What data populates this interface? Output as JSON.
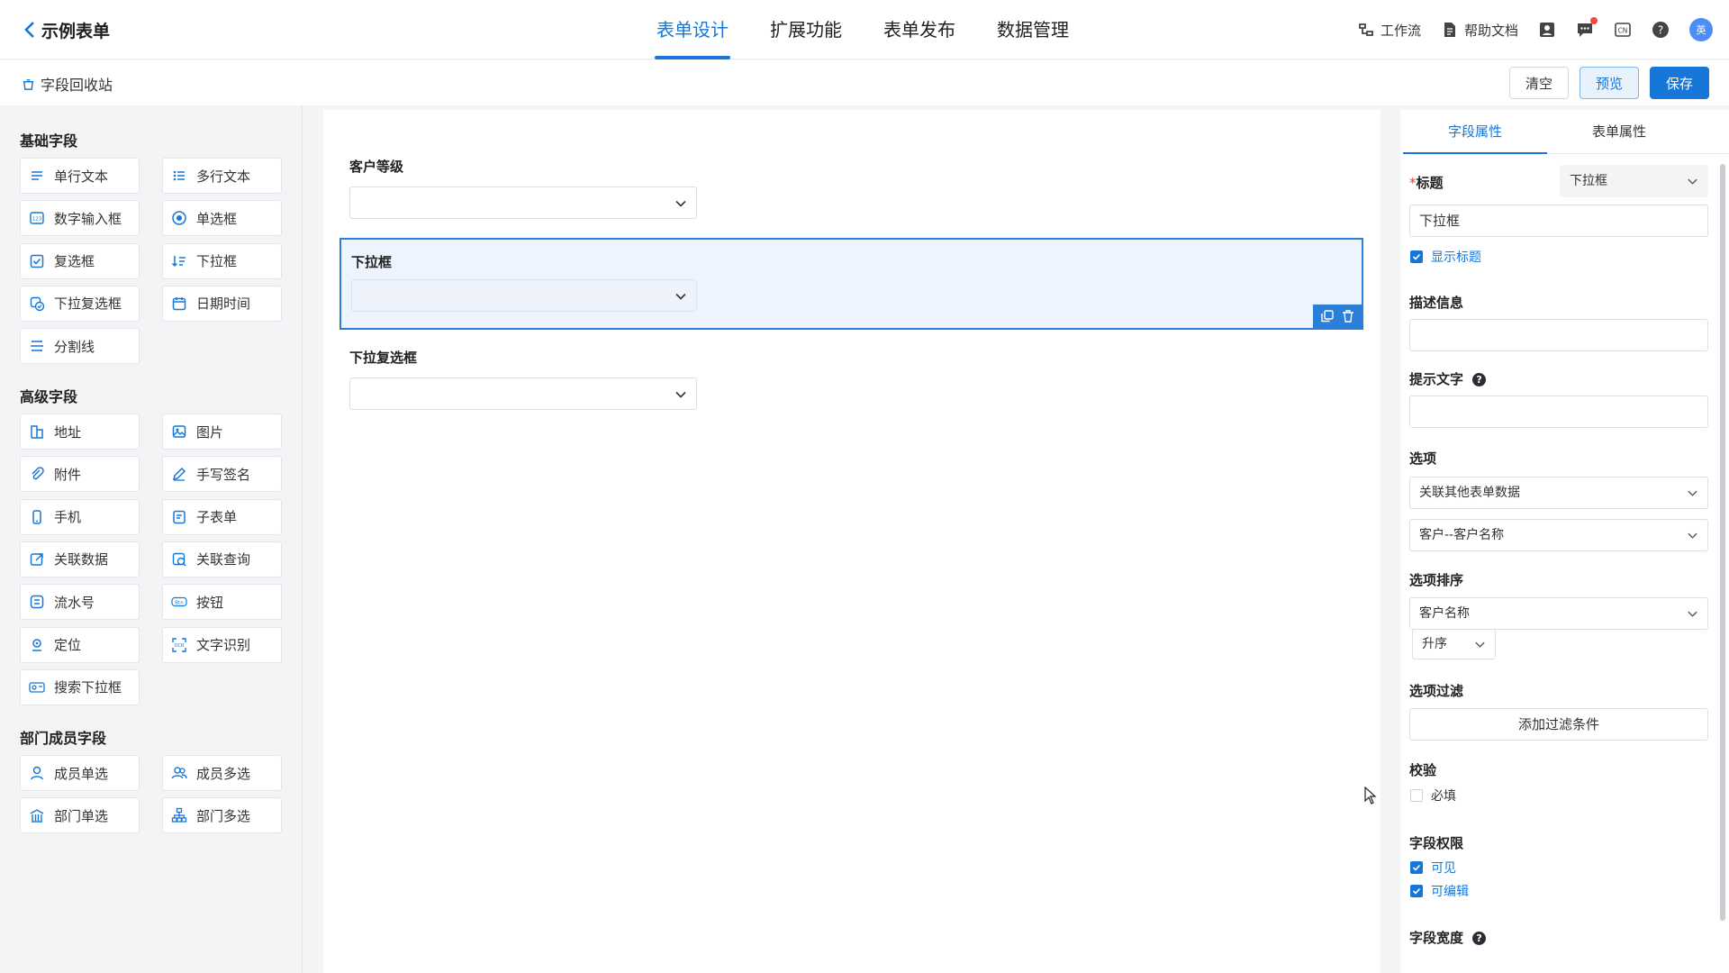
{
  "header": {
    "back_title": "示例表单",
    "tabs": [
      {
        "label": "表单设计",
        "active": true
      },
      {
        "label": "扩展功能",
        "active": false
      },
      {
        "label": "表单发布",
        "active": false
      },
      {
        "label": "数据管理",
        "active": false
      }
    ],
    "tools": {
      "workflow": "工作流",
      "help_docs": "帮助文档"
    },
    "avatar_text": "英",
    "accent_color": "#1677d8"
  },
  "subbar": {
    "recycle": "字段回收站",
    "clear": "清空",
    "preview": "预览",
    "save": "保存"
  },
  "palette": {
    "groups": [
      {
        "title": "基础字段",
        "items": [
          {
            "label": "单行文本",
            "icon": "single-line-icon"
          },
          {
            "label": "多行文本",
            "icon": "multi-line-icon"
          },
          {
            "label": "数字输入框",
            "icon": "number-icon"
          },
          {
            "label": "单选框",
            "icon": "radio-icon"
          },
          {
            "label": "复选框",
            "icon": "checkbox-icon"
          },
          {
            "label": "下拉框",
            "icon": "dropdown-icon"
          },
          {
            "label": "下拉复选框",
            "icon": "multi-dropdown-icon"
          },
          {
            "label": "日期时间",
            "icon": "calendar-icon"
          },
          {
            "label": "分割线",
            "icon": "divider-icon"
          }
        ]
      },
      {
        "title": "高级字段",
        "items": [
          {
            "label": "地址",
            "icon": "building-icon"
          },
          {
            "label": "图片",
            "icon": "image-icon"
          },
          {
            "label": "附件",
            "icon": "paperclip-icon"
          },
          {
            "label": "手写签名",
            "icon": "pen-icon"
          },
          {
            "label": "手机",
            "icon": "phone-icon"
          },
          {
            "label": "子表单",
            "icon": "subform-icon"
          },
          {
            "label": "关联数据",
            "icon": "link-data-icon"
          },
          {
            "label": "关联查询",
            "icon": "link-query-icon"
          },
          {
            "label": "流水号",
            "icon": "serial-icon"
          },
          {
            "label": "按钮",
            "icon": "button-icon"
          },
          {
            "label": "定位",
            "icon": "location-icon"
          },
          {
            "label": "文字识别",
            "icon": "ocr-icon"
          },
          {
            "label": "搜索下拉框",
            "icon": "search-dropdown-icon"
          }
        ]
      },
      {
        "title": "部门成员字段",
        "items": [
          {
            "label": "成员单选",
            "icon": "user-icon"
          },
          {
            "label": "成员多选",
            "icon": "users-icon"
          },
          {
            "label": "部门单选",
            "icon": "department-icon"
          },
          {
            "label": "部门多选",
            "icon": "org-chart-icon"
          }
        ]
      }
    ]
  },
  "canvas": {
    "fields": [
      {
        "label": "客户等级",
        "selected": false
      },
      {
        "label": "下拉框",
        "selected": true
      },
      {
        "label": "下拉复选框",
        "selected": false
      }
    ]
  },
  "props": {
    "tabs": [
      "字段属性",
      "表单属性"
    ],
    "title_label": "标题",
    "title_type": "下拉框",
    "title_value": "下拉框",
    "show_title": "显示标题",
    "desc_label": "描述信息",
    "hint_label": "提示文字",
    "options_label": "选项",
    "options_source": "关联其他表单数据",
    "options_field": "客户--客户名称",
    "sort_label": "选项排序",
    "sort_field": "客户名称",
    "sort_order": "升序",
    "filter_label": "选项过滤",
    "filter_button": "添加过滤条件",
    "validate_label": "校验",
    "required": "必填",
    "perm_label": "字段权限",
    "visible": "可见",
    "editable": "可编辑",
    "width_label": "字段宽度"
  }
}
